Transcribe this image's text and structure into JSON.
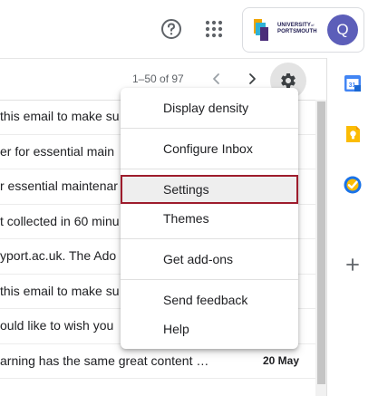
{
  "header": {
    "help_icon": "help-circle-icon",
    "apps_icon": "apps-grid-icon",
    "org_logo": {
      "line1": "UNIVERSITY",
      "line1_of": "of",
      "line2": "PORTSMOUTH",
      "color": "#1d1a4f"
    },
    "avatar_letter": "Q",
    "avatar_color": "#5c5eb9"
  },
  "toolbar": {
    "pagination": "1–50 of 97",
    "prev_icon": "chevron-left-icon",
    "next_icon": "chevron-right-icon",
    "settings_icon": "gear-icon"
  },
  "emails": [
    {
      "snippet": "this email to make su"
    },
    {
      "snippet": "er for essential main"
    },
    {
      "snippet": "r essential maintenar"
    },
    {
      "snippet": "t collected in 60 minu"
    },
    {
      "snippet": "yport.ac.uk. The Ado"
    },
    {
      "snippet": "this email to make su"
    },
    {
      "snippet": "ould like to wish you"
    },
    {
      "snippet": "arning has the same great content …",
      "date": "20 May"
    }
  ],
  "menu": {
    "items": [
      {
        "label": "Display density"
      },
      {
        "label": "Configure Inbox"
      },
      {
        "label": "Settings",
        "selected": true
      },
      {
        "label": "Themes"
      },
      {
        "label": "Get add-ons"
      },
      {
        "label": "Send feedback"
      },
      {
        "label": "Help"
      }
    ],
    "highlight_border_color": "#9e1c2c"
  },
  "side_panel": {
    "icons": [
      "calendar-icon",
      "keep-icon",
      "tasks-icon",
      "add-icon"
    ]
  }
}
